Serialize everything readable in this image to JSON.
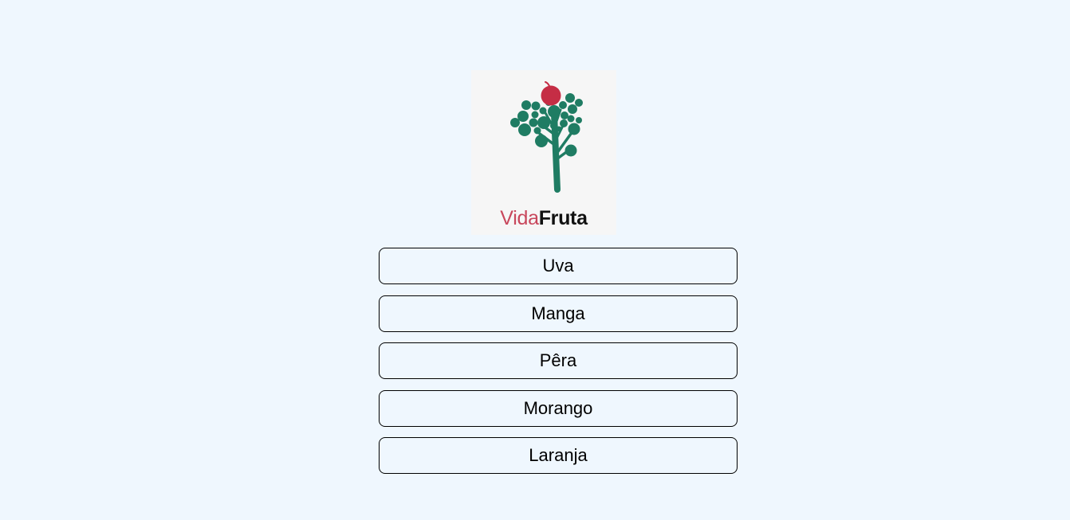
{
  "brand": {
    "name_part1": "Vida",
    "name_part2": "Fruta",
    "icon": "apple-tree-icon",
    "colors": {
      "apple": "#c52d45",
      "tree": "#1f7c63",
      "vida_text": "#c8475c",
      "fruta_text": "#111111",
      "logo_bg": "#f6f6f6"
    }
  },
  "fruits": [
    {
      "label": "Uva"
    },
    {
      "label": "Manga"
    },
    {
      "label": "Pêra"
    },
    {
      "label": "Morango"
    },
    {
      "label": "Laranja"
    }
  ],
  "page": {
    "background": "#eff7fe"
  }
}
